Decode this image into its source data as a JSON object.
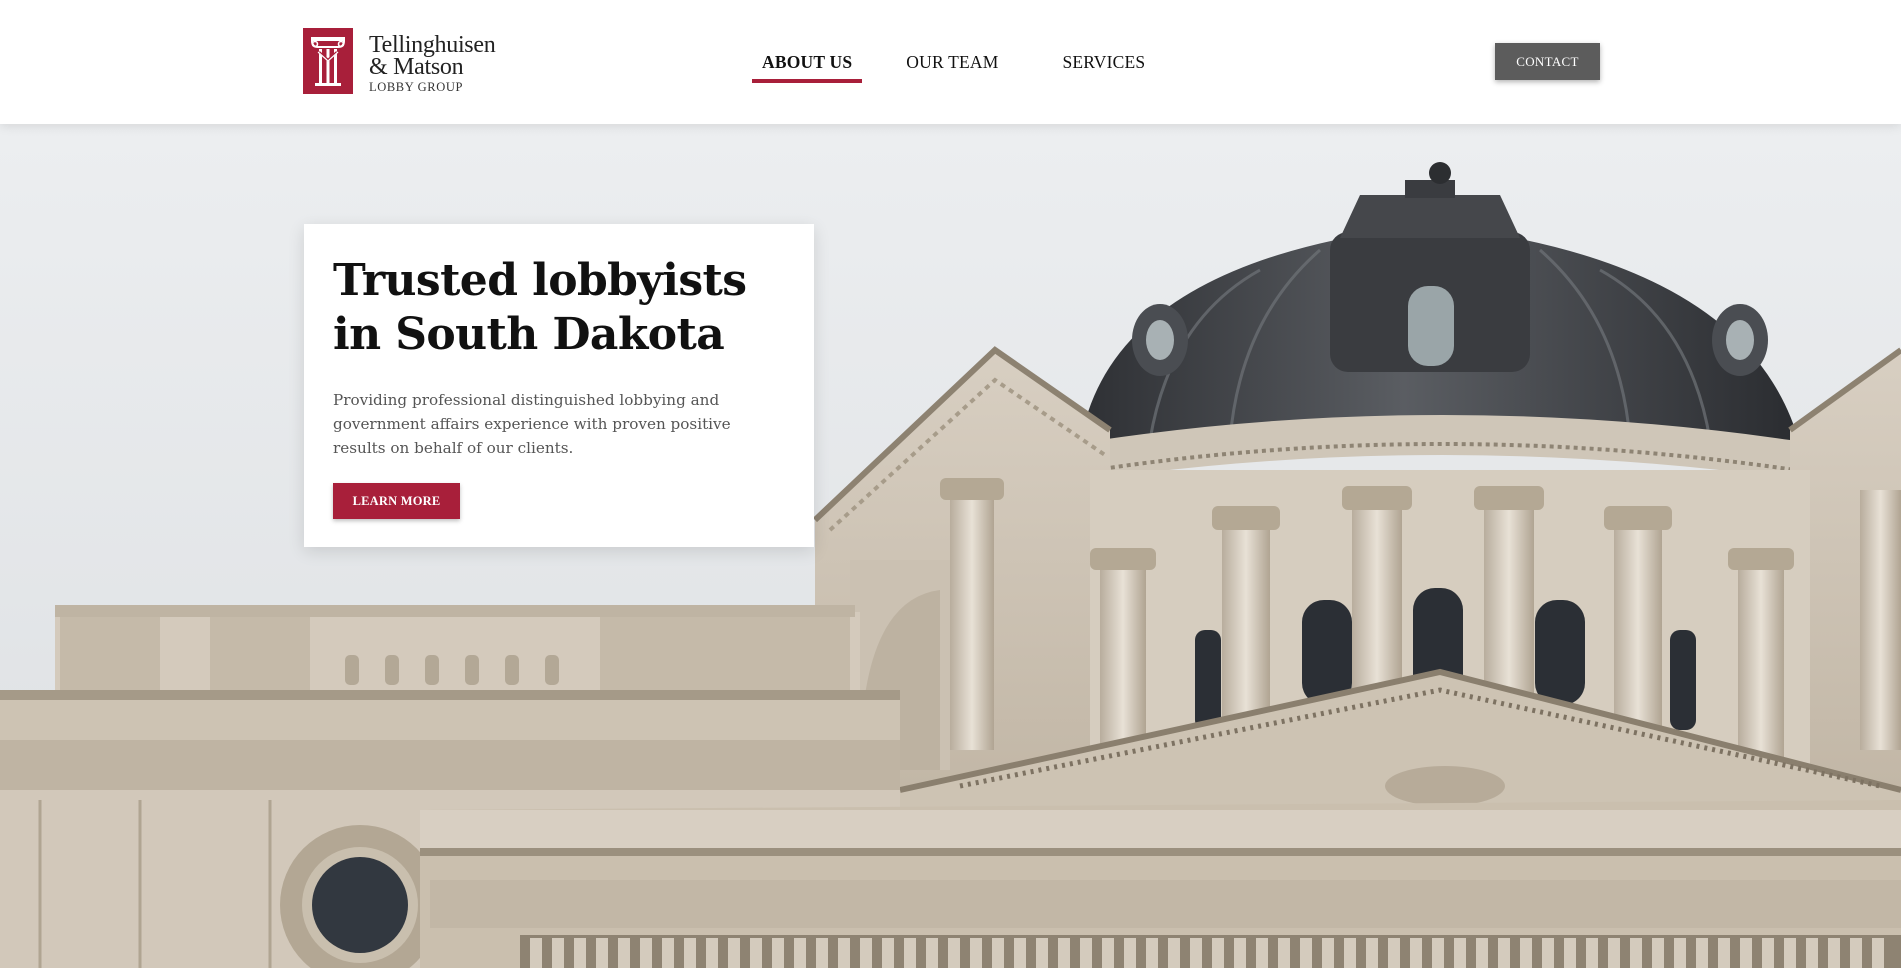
{
  "header": {
    "logo": {
      "line1": "Tellinghuisen",
      "line2": "& Matson",
      "line3": "LOBBY GROUP",
      "icon": "column-icon"
    },
    "nav": [
      {
        "label": "ABOUT US",
        "active": true
      },
      {
        "label": "OUR TEAM",
        "active": false
      },
      {
        "label": "SERVICES",
        "active": false
      }
    ],
    "contact_label": "CONTACT"
  },
  "hero": {
    "title_line1": "Trusted lobbyists",
    "title_line2": "in South Dakota",
    "description": "Providing professional distinguished lobbying and government affairs experience with proven positive results on behalf of our clients.",
    "button_label": "LEARN MORE",
    "image": "capitol-dome-photo"
  },
  "colors": {
    "brand": "#a81f3a",
    "contact_button": "#5c5c5c",
    "stone": "#cfc5b6",
    "dome": "#3f4145"
  }
}
